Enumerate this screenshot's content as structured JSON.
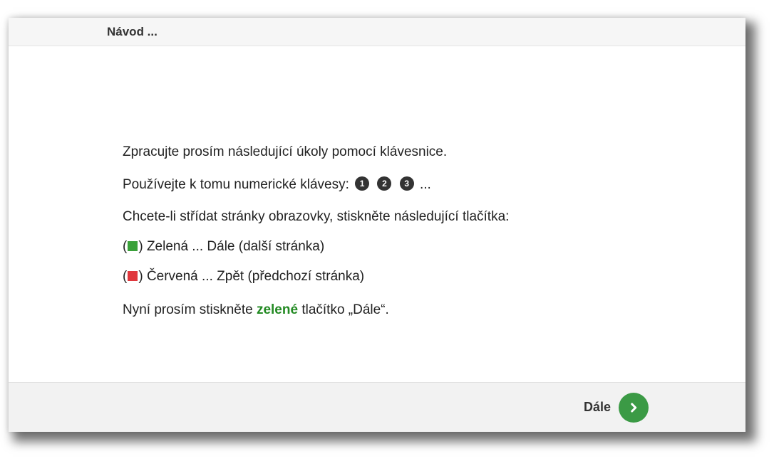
{
  "header": {
    "title": "Návod ..."
  },
  "instructions": {
    "line1": "Zpracujte prosím následující úkoly pomocí klávesnice.",
    "numeric_keys": {
      "text": "Používejte k tomu numerické klávesy:",
      "keys": [
        "1",
        "2",
        "3"
      ],
      "suffix": "...",
      "badge_color": "#333333"
    },
    "line3": "Chcete-li střídat stránky obrazovky, stiskněte následující tlačítka:",
    "paren_open": "(",
    "paren_close": ")",
    "legend": [
      {
        "color": "#3aa13a",
        "label": "Zelená ... Dále (další stránka)"
      },
      {
        "color": "#e0373d",
        "label": "Červená ... Zpět (předchozí stránka)"
      }
    ],
    "final": {
      "before": "Nyní prosím stiskněte",
      "highlight": "zelené",
      "highlight_color": "#238a23",
      "after": "tlačítko „Dále“."
    }
  },
  "footer": {
    "next_label": "Dále",
    "next_icon": "chevron-right-icon",
    "next_button_color": "#3b9a45"
  }
}
